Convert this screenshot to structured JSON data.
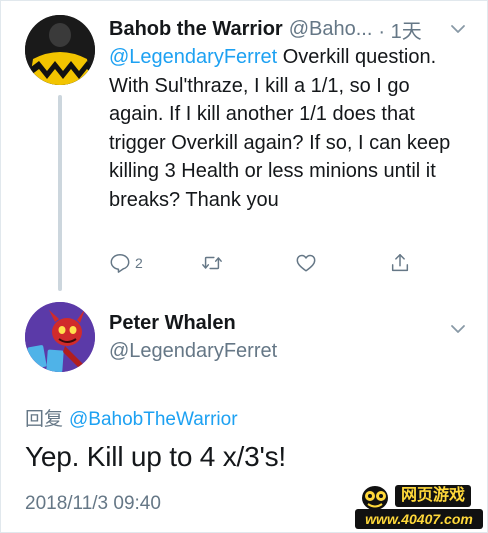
{
  "tweet1": {
    "display_name": "Bahob the Warrior",
    "handle": "@Baho...",
    "time": "· 1天",
    "mention": "@LegendaryFerret",
    "body_after_mention": " Overkill question. With Sul'thraze, I kill a 1/1, so I go again. If I kill another 1/1 does that trigger Overkill again? If so, I can keep killing 3 Health or less minions until it breaks? Thank you",
    "reply_count": "2"
  },
  "tweet2": {
    "display_name": "Peter Whalen",
    "handle": "@LegendaryFerret",
    "reply_prefix": "回复",
    "reply_mention": "@BahobTheWarrior",
    "body": "Yep. Kill up to 4 x/3's!",
    "timestamp": "2018/11/3 09:40"
  },
  "watermark": {
    "top_text": "网页游戏",
    "bottom_text": "www.40407.com"
  },
  "colors": {
    "link": "#1da1f2",
    "secondary": "#657786",
    "text": "#14171a",
    "thread_line": "#ccd6dd"
  },
  "icons": [
    "reply-icon",
    "retweet-icon",
    "like-icon",
    "share-icon",
    "chevron-down-icon"
  ]
}
